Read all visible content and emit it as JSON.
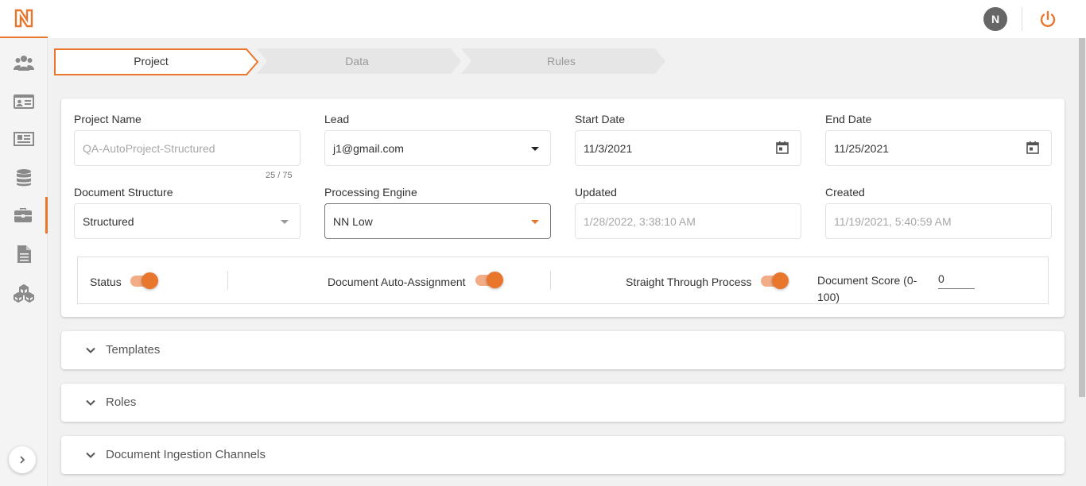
{
  "sidebar": {
    "items": [
      {
        "icon": "users-icon"
      },
      {
        "icon": "id-card-icon"
      },
      {
        "icon": "newspaper-icon"
      },
      {
        "icon": "database-icon"
      },
      {
        "icon": "briefcase-icon",
        "active": true
      },
      {
        "icon": "document-icon"
      },
      {
        "icon": "cubes-icon"
      }
    ],
    "expand_icon": "chevron-right-icon"
  },
  "topbar": {
    "avatar_initial": "N",
    "power_icon": "power-icon"
  },
  "stepper": {
    "steps": [
      {
        "label": "Project",
        "active": true
      },
      {
        "label": "Data",
        "active": false
      },
      {
        "label": "Rules",
        "active": false
      }
    ]
  },
  "form": {
    "project_name": {
      "label": "Project Name",
      "placeholder": "QA-AutoProject-Structured",
      "counter": "25 / 75"
    },
    "lead": {
      "label": "Lead",
      "value": "j1@gmail.com"
    },
    "start_date": {
      "label": "Start Date",
      "value": "11/3/2021"
    },
    "end_date": {
      "label": "End Date",
      "value": "11/25/2021"
    },
    "document_structure": {
      "label": "Document Structure",
      "value": "Structured"
    },
    "processing_engine": {
      "label": "Processing Engine",
      "value": "NN Low"
    },
    "updated": {
      "label": "Updated",
      "value": "1/28/2022, 3:38:10 AM"
    },
    "created": {
      "label": "Created",
      "value": "11/19/2021, 5:40:59 AM"
    }
  },
  "toggles": {
    "status": {
      "label": "Status",
      "on": true
    },
    "auto_assignment": {
      "label": "Document Auto-Assignment",
      "on": true
    },
    "straight_through": {
      "label": "Straight Through Process",
      "on": true
    },
    "score": {
      "label_line1": "Document Score (0-",
      "label_line2": "100)",
      "value": "0"
    }
  },
  "accordions": [
    {
      "label": "Templates"
    },
    {
      "label": "Roles"
    },
    {
      "label": "Document Ingestion Channels"
    }
  ],
  "colors": {
    "accent": "#e8762d",
    "accent_light": "#f2ad86",
    "step_inactive": "#e6e6e6"
  }
}
